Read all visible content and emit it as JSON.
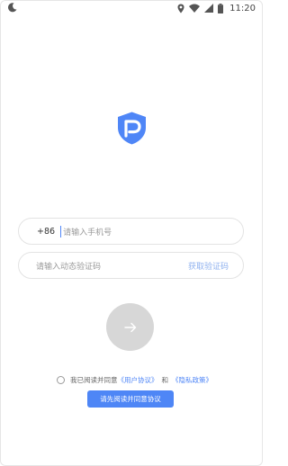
{
  "status_bar": {
    "time": "11:20",
    "icons": [
      "moon-icon",
      "location-icon",
      "wifi-icon",
      "signal-icon",
      "battery-icon"
    ]
  },
  "logo": {
    "icon": "shield-p-logo",
    "color": "#4f86f7"
  },
  "phone_field": {
    "prefix": "+86",
    "placeholder": "请输入手机号",
    "value": ""
  },
  "code_field": {
    "placeholder": "请输入动态验证码",
    "value": "",
    "get_code_label": "获取验证码"
  },
  "submit": {
    "icon": "arrow-right-icon",
    "enabled": false
  },
  "agreement": {
    "checked": false,
    "prefix": "我已阅读并同意",
    "user_agreement": "《用户协议》",
    "and": "和",
    "privacy_policy": "《隐私政策》"
  },
  "toast": {
    "message": "请先阅读并同意协议"
  },
  "colors": {
    "accent": "#4f86f7",
    "button_disabled": "#d7d7d7",
    "placeholder": "#9a9a9a"
  }
}
